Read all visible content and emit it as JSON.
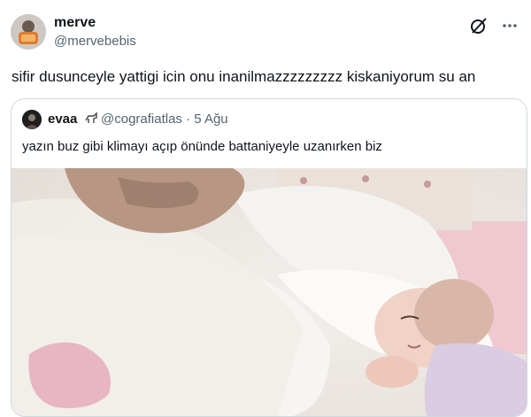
{
  "author": {
    "display_name": "merve",
    "handle": "@mervebebis"
  },
  "tweet": {
    "text": "sifir dusunceyle yattigi icin onu inanilmazzzzzzzzz kiskaniyorum su an"
  },
  "header_icons": [
    "grok-icon",
    "more-icon"
  ],
  "quoted": {
    "author_name": "evaa",
    "handle": "@cografiatlas",
    "separator": "·",
    "date": "5 Ağu",
    "text": "yazın buz gibi klimayı açıp önünde battaniyeyle uzanırken biz",
    "media_description_icon": "photo-of-newborn-under-blanket"
  },
  "colors": {
    "text": "#0f1419",
    "secondary": "#536471",
    "border": "#cfd9de"
  }
}
